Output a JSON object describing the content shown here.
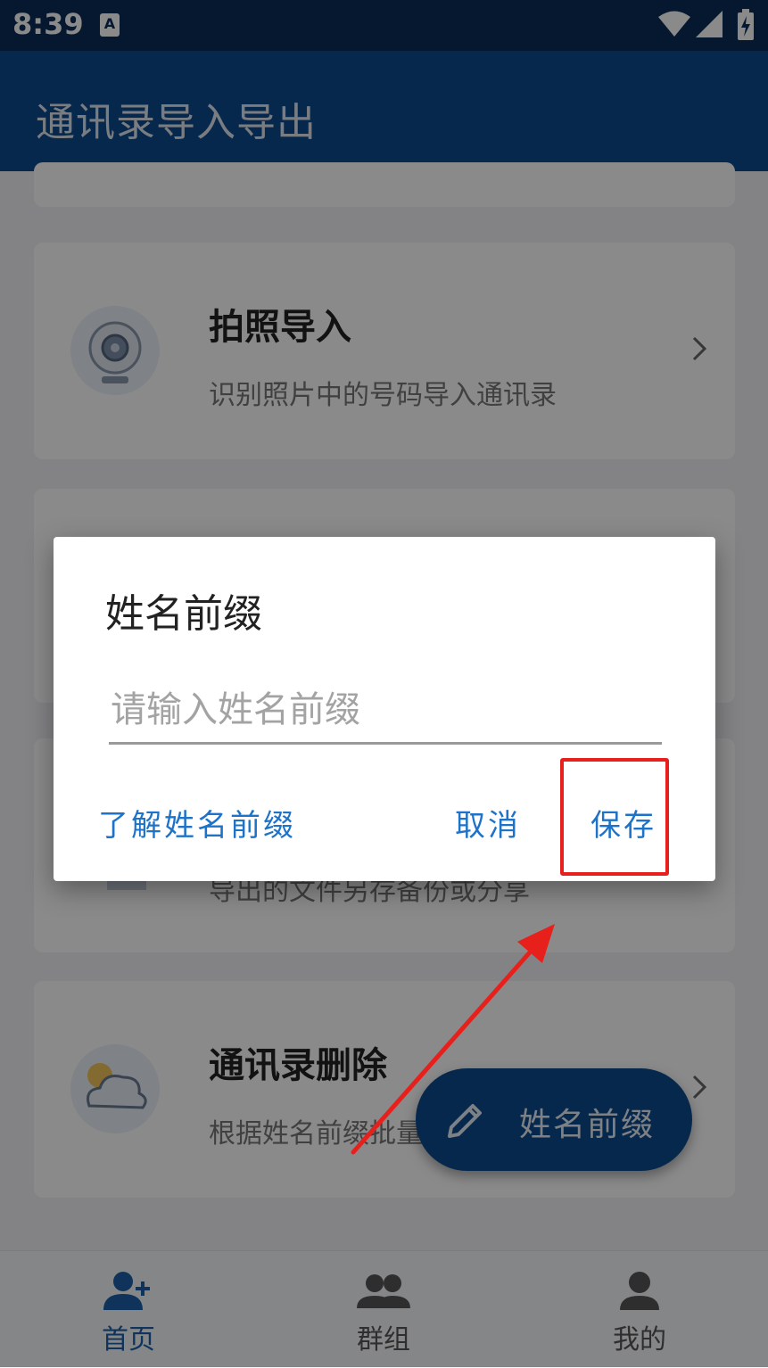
{
  "status_bar": {
    "time": "8:39",
    "notification_icon": "A"
  },
  "app_bar": {
    "title": "通讯录导入导出"
  },
  "cards": [
    {
      "title": "拍照导入",
      "subtitle": "识别照片中的号码导入通讯录",
      "icon": "camera-icon"
    },
    {
      "title": "",
      "subtitle": "导出的文件另存备份或分享",
      "icon": "document-icon"
    },
    {
      "title": "通讯录删除",
      "subtitle": "根据姓名前缀批量",
      "icon": "cloud-icon"
    }
  ],
  "fab": {
    "label": "姓名前缀",
    "icon": "pencil-icon"
  },
  "tabs": [
    {
      "label": "首页",
      "icon": "add-person-icon",
      "active": true
    },
    {
      "label": "群组",
      "icon": "group-icon",
      "active": false
    },
    {
      "label": "我的",
      "icon": "person-icon",
      "active": false
    }
  ],
  "dialog": {
    "title": "姓名前缀",
    "input_placeholder": "请输入姓名前缀",
    "input_value": "",
    "learn_button": "了解姓名前缀",
    "cancel_button": "取消",
    "save_button": "保存"
  },
  "colors": {
    "primary": "#0e4a8e",
    "status_bar": "#0a2d5a",
    "accent_text": "#1e73c8",
    "highlight": "#e8201c"
  }
}
